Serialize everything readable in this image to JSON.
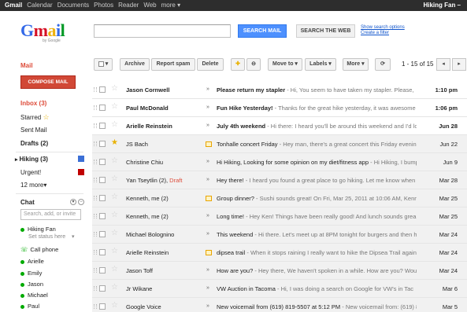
{
  "topbar": {
    "nav": [
      "Gmail",
      "Calendar",
      "Documents",
      "Photos",
      "Reader",
      "Web",
      "more ▾"
    ],
    "user": "Hiking Fan –"
  },
  "logo": {
    "by": "by Google"
  },
  "search": {
    "search_mail": "SEARCH MAIL",
    "search_web": "SEARCH THE WEB",
    "show_options": "Show search options",
    "create_filter": "Create a filter"
  },
  "sidebar": {
    "title": "Mail",
    "compose": "COMPOSE MAIL",
    "items": [
      {
        "label": "Inbox (3)"
      },
      {
        "label": "Starred"
      },
      {
        "label": "Sent Mail"
      },
      {
        "label": "Drafts (2)"
      },
      {
        "label": "Hiking (3)"
      },
      {
        "label": "Urgent!"
      },
      {
        "label": "12 more▾"
      }
    ],
    "label_colors": {
      "hiking": "#3b6fd6",
      "urgent": "#c00000"
    }
  },
  "chat": {
    "title": "Chat",
    "search_placeholder": "Search, add, or invite",
    "me": "Hiking Fan",
    "set_status": "Set status here",
    "contacts": [
      "Call phone",
      "Arielle",
      "Emily",
      "Jason",
      "Michael",
      "Paul"
    ]
  },
  "toolbar": {
    "archive": "Archive",
    "report_spam": "Report spam",
    "delete": "Delete",
    "move_to": "Move to ▾",
    "labels": "Labels ▾",
    "more": "More ▾",
    "refresh": "⟳",
    "count": "1 - 15 of 15",
    "prev": "◂",
    "next": "▸"
  },
  "messages": [
    {
      "sender": "Jason Cornwell",
      "draft": "",
      "subject": "Please return my stapler",
      "preview": " - Hi, You seem to have taken my stapler. Please,",
      "date": "1:10 pm",
      "unread": true,
      "starred": false,
      "marker": "»"
    },
    {
      "sender": "Paul McDonald",
      "draft": "",
      "subject": "Fun Hike Yesterday!",
      "preview": " - Thanks for the great hike yesterday, it was awesome",
      "date": "1:06 pm",
      "unread": true,
      "starred": false,
      "marker": "»"
    },
    {
      "sender": "Arielle Reinstein",
      "draft": "",
      "subject": "July 4th weekend",
      "preview": " - Hi there: I heard you'll be around this weekend and I'd lo",
      "date": "Jun 28",
      "unread": true,
      "starred": false,
      "marker": "»"
    },
    {
      "sender": "JS Bach",
      "draft": "",
      "subject": "Tonhalle concert Friday",
      "preview": " - Hey man, there's a great concert this Friday evenin",
      "date": "Jun 22",
      "unread": false,
      "starred": true,
      "marker": "cal"
    },
    {
      "sender": "Christine Chiu",
      "draft": "",
      "subject": "Hi Hiking, Looking for some opinion on my diet/fitness app",
      "preview": " - Hi Hiking, I bumped in",
      "date": "Jun 9",
      "unread": false,
      "starred": false,
      "marker": "»"
    },
    {
      "sender": "Yan Tseytlin (2),",
      "draft": " Draft",
      "subject": "Hey there!",
      "preview": " - I heard you found a great place to go hiking. Let me know when",
      "date": "Mar 28",
      "unread": false,
      "starred": false,
      "marker": "»"
    },
    {
      "sender": "Kenneth, me (2)",
      "draft": "",
      "subject": "Group dinner?",
      "preview": " - Sushi sounds great! On Fri, Mar 25, 2011 at 10:06 AM, Kenn",
      "date": "Mar 25",
      "unread": false,
      "starred": false,
      "marker": "cal"
    },
    {
      "sender": "Kenneth, me (2)",
      "draft": "",
      "subject": "Long time!",
      "preview": " - Hey Ken! Things have been really good! And lunch sounds grea",
      "date": "Mar 25",
      "unread": false,
      "starred": false,
      "marker": "»"
    },
    {
      "sender": "Michael Bolognino",
      "draft": "",
      "subject": "This weekend",
      "preview": " - Hi there. Let's meet up at 8PM tonight for burgers and then h",
      "date": "Mar 24",
      "unread": false,
      "starred": false,
      "marker": "»"
    },
    {
      "sender": "Arielle Reinstein",
      "draft": "",
      "subject": "dipsea trail",
      "preview": " - When it stops raining I really want to hike the Dipsea Trail again",
      "date": "Mar 24",
      "unread": false,
      "starred": false,
      "marker": "cal"
    },
    {
      "sender": "Jason Toff",
      "draft": "",
      "subject": "How are you?",
      "preview": " - Hey there, We haven't spoken in a while. How are you? Wou",
      "date": "Mar 24",
      "unread": false,
      "starred": false,
      "marker": "»"
    },
    {
      "sender": "Jr Wikane",
      "draft": "",
      "subject": "VW Auction in Tacoma",
      "preview": " - Hi, I was doing a search on Google for VW's in Tac",
      "date": "Mar 6",
      "unread": false,
      "starred": false,
      "marker": "»"
    },
    {
      "sender": "Google Voice",
      "draft": "",
      "subject": "New voicemail from (619) 819-5507 at 5:12 PM",
      "preview": " - New voicemail from: (619) 819-",
      "date": "Mar 5",
      "unread": false,
      "starred": false,
      "marker": "»"
    }
  ]
}
